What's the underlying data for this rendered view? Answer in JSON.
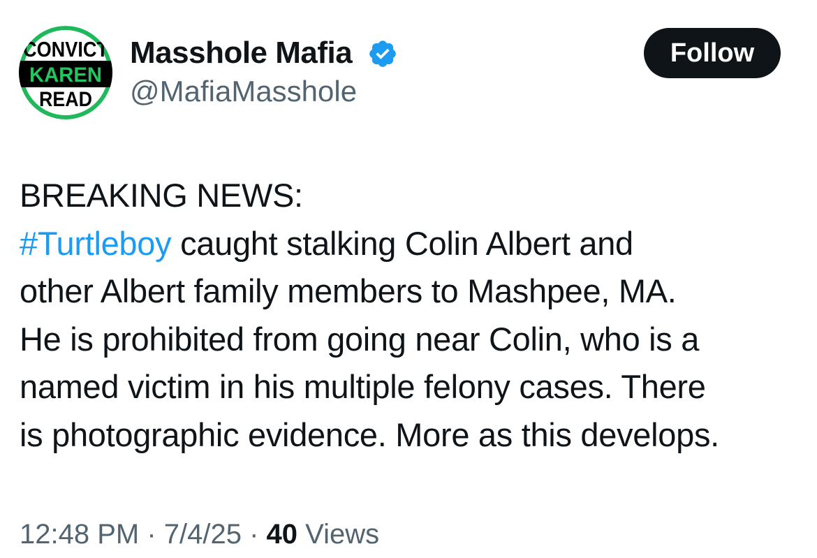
{
  "user": {
    "display_name": "Masshole Mafia",
    "handle": "@MafiaMasshole",
    "verified": true,
    "verified_icon": "verified-badge-icon",
    "avatar": {
      "line1": "CONVICT",
      "line2": "KAREN",
      "line3": "READ",
      "ring_color": "#1fb85a",
      "band_color": "#000000",
      "band_text_color": "#22c55e"
    }
  },
  "follow_button": {
    "label": "Follow"
  },
  "tweet": {
    "line1": "BREAKING NEWS:",
    "hashtag": "#Turtleboy",
    "line2_rest": " caught stalking Colin Albert and",
    "line3": "other Albert family members to Mashpee, MA.",
    "line4": "He is prohibited from going near Colin, who is a",
    "line5": "named victim in his multiple felony cases. There",
    "line6": "is photographic evidence. More as this develops."
  },
  "meta": {
    "time": "12:48 PM",
    "separator": " · ",
    "date": "7/4/25",
    "views_count": "40",
    "views_label": " Views"
  },
  "colors": {
    "text": "#0f1419",
    "secondary": "#536471",
    "link": "#1d9bf0",
    "verified": "#1d9bf0",
    "button_bg": "#0f1419"
  }
}
